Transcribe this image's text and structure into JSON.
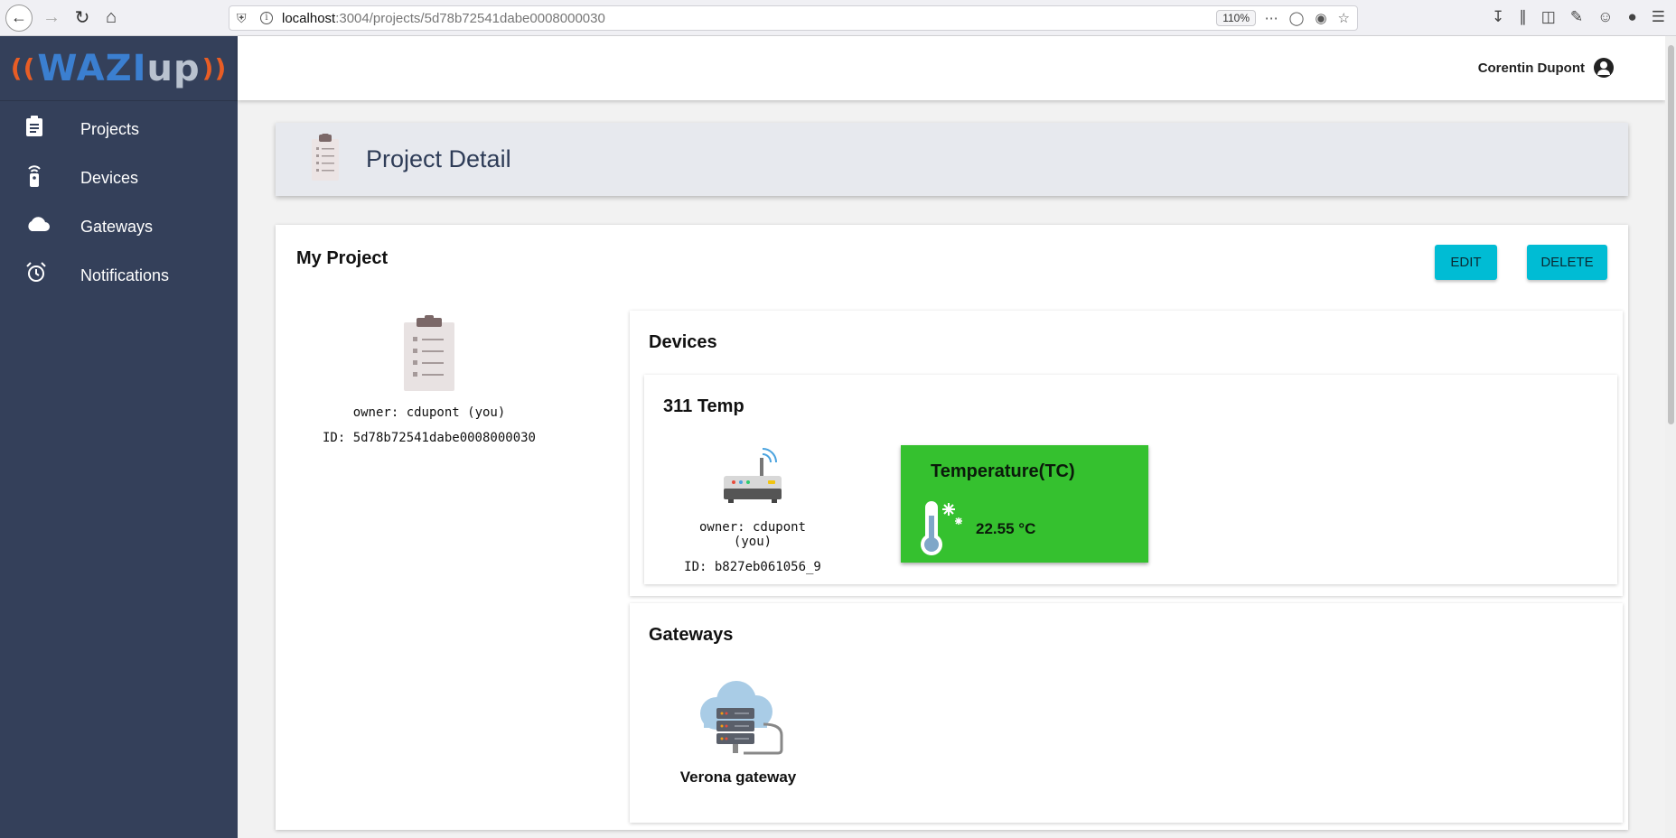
{
  "browser": {
    "url_host": "localhost",
    "url_path": ":3004/projects/5d78b72541dabe0008000030",
    "zoom": "110%"
  },
  "sidebar": {
    "logo_text_a": "WAZI",
    "logo_text_b": "up",
    "items": [
      {
        "label": "Projects",
        "icon": "clipboard-icon"
      },
      {
        "label": "Devices",
        "icon": "device-icon"
      },
      {
        "label": "Gateways",
        "icon": "cloud-icon"
      },
      {
        "label": "Notifications",
        "icon": "alarm-icon"
      }
    ]
  },
  "header": {
    "user_name": "Corentin Dupont"
  },
  "page": {
    "title": "Project Detail"
  },
  "project": {
    "name": "My Project",
    "edit_label": "EDIT",
    "delete_label": "DELETE",
    "owner": "owner: cdupont (you)",
    "id": "ID: 5d78b72541dabe0008000030"
  },
  "devices": {
    "title": "Devices",
    "items": [
      {
        "name": "311 Temp",
        "owner": "owner: cdupont (you)",
        "id": "ID: b827eb061056_9",
        "sensor": {
          "name": "Temperature(TC)",
          "value": "22.55 °C",
          "color": "#35c12f"
        }
      }
    ]
  },
  "gateways": {
    "title": "Gateways",
    "items": [
      {
        "name": "Verona gateway"
      }
    ]
  },
  "colors": {
    "sidebar": "#34405a",
    "accent_button": "#00bcd4",
    "header_band": "#e7e9ee"
  }
}
